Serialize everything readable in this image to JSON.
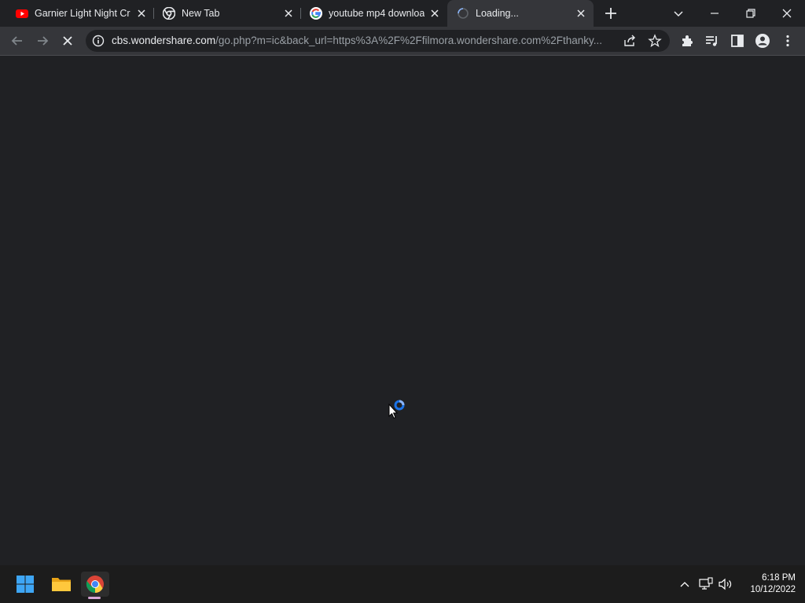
{
  "tabs": [
    {
      "title": "Garnier Light Night Cre",
      "favicon": "youtube-icon"
    },
    {
      "title": "New Tab",
      "favicon": "chrome-icon"
    },
    {
      "title": "youtube mp4 downloa",
      "favicon": "google-icon"
    },
    {
      "title": "Loading...",
      "favicon": "loading-spinner-icon",
      "active": true
    }
  ],
  "address_bar": {
    "host": "cbs.wondershare.com",
    "path": "/go.php?m=ic&back_url=https%3A%2F%2Ffilmora.wondershare.com%2Fthanky..."
  },
  "taskbar": {
    "time": "6:18 PM",
    "date": "10/12/2022"
  },
  "colors": {
    "background": "#202124",
    "toolbar": "#35363a",
    "accent": "#1a73e8",
    "taskbar": "#1c1c1c"
  }
}
